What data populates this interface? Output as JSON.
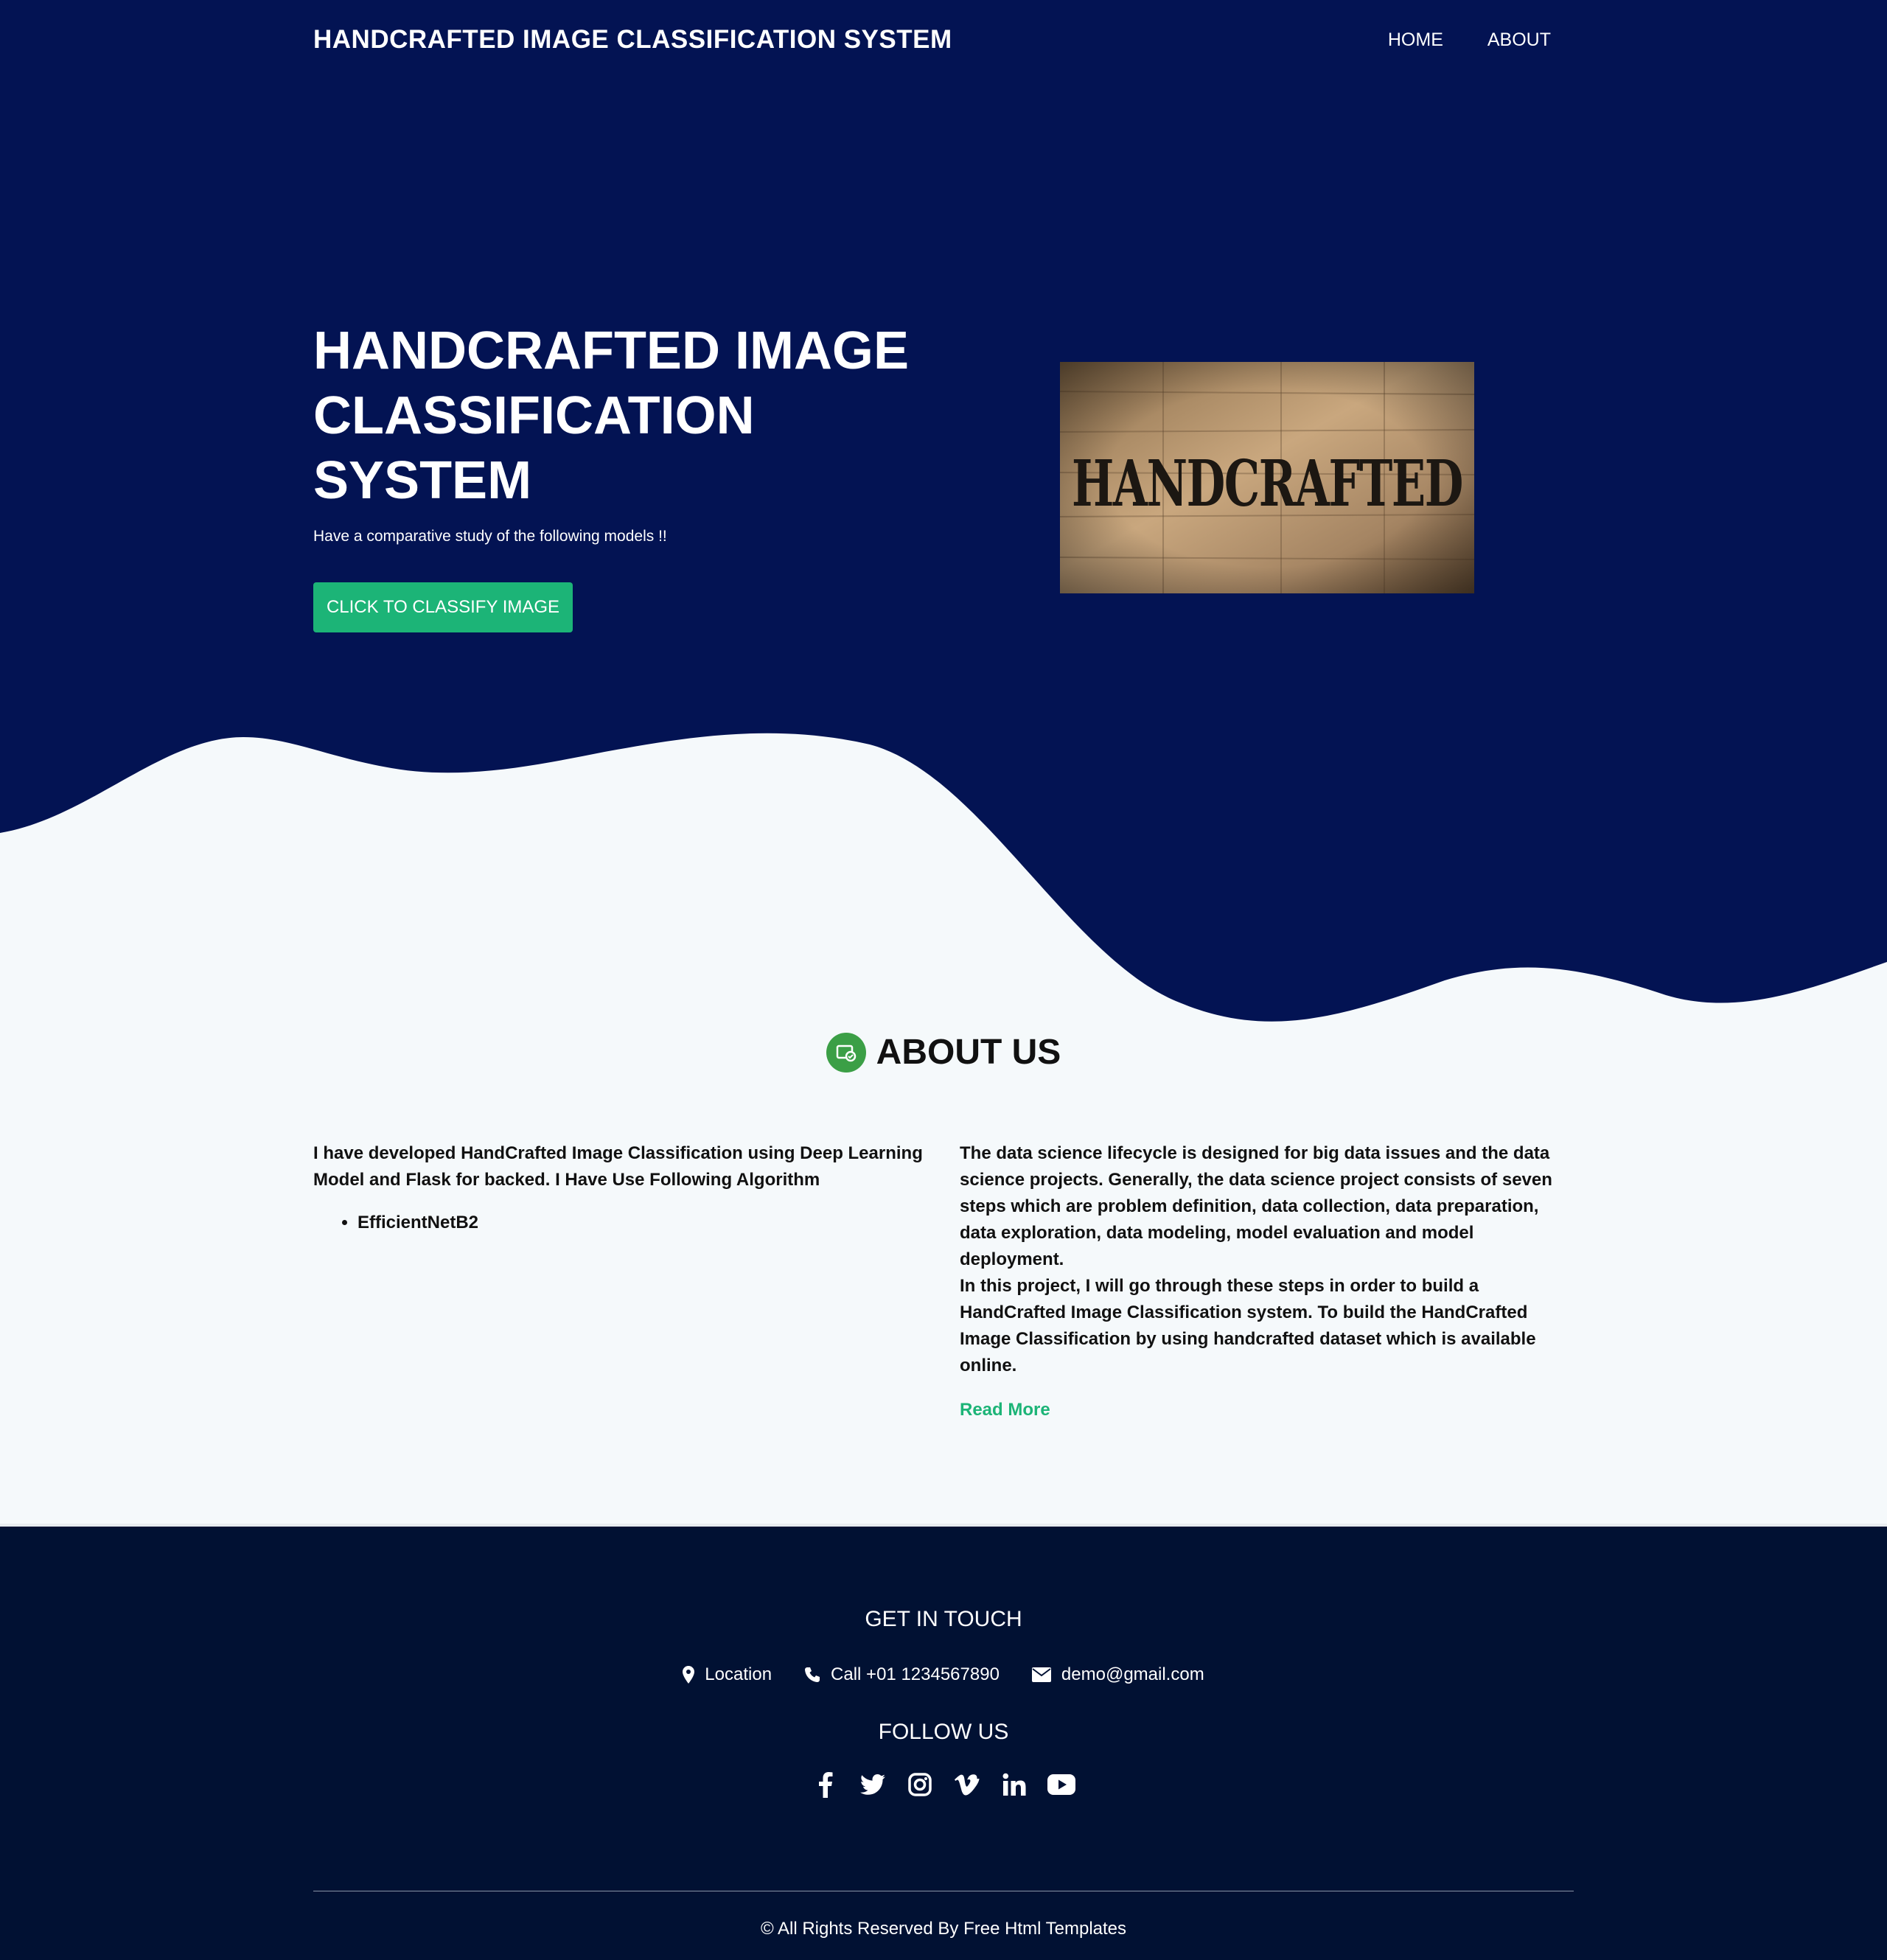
{
  "colors": {
    "hero_bg": "#031353",
    "accent_green": "#1cb477",
    "footer_bg": "#011133",
    "page_bg": "#f5f9fb"
  },
  "header": {
    "brand": "HANDCRAFTED IMAGE CLASSIFICATION SYSTEM",
    "nav": [
      "HOME",
      "ABOUT"
    ]
  },
  "hero": {
    "title": "HANDCRAFTED IMAGE CLASSIFICATION SYSTEM",
    "subtitle": "Have a comparative study of the following models !!",
    "button": "CLICK TO CLASSIFY IMAGE",
    "image_text": "HANDCRAFTED"
  },
  "about": {
    "icon": "about-badge-icon",
    "title": "ABOUT US",
    "left_text": "I have developed HandCrafted Image Classification using Deep Learning Model and Flask for backed. I Have Use Following Algorithm",
    "algorithms": [
      "EfficientNetB2"
    ],
    "right_p1": "The data science lifecycle is designed for big data issues and the data science projects. Generally, the data science project consists of seven steps which are problem definition, data collection, data preparation, data exploration, data modeling, model evaluation and model deployment.",
    "right_p2": "In this project, I will go through these steps in order to build a HandCrafted Image Classification system. To build the HandCrafted Image Classification by using handcrafted dataset which is available online.",
    "read_more": "Read More"
  },
  "footer": {
    "get_in_touch": "GET IN TOUCH",
    "location": "Location",
    "phone": "Call +01 1234567890",
    "email": "demo@gmail.com",
    "follow_us": "FOLLOW US",
    "social_icons": [
      "facebook-icon",
      "twitter-icon",
      "instagram-icon",
      "vimeo-icon",
      "linkedin-icon",
      "youtube-icon"
    ],
    "copyright": "© All Rights Reserved By Free Html Templates"
  }
}
